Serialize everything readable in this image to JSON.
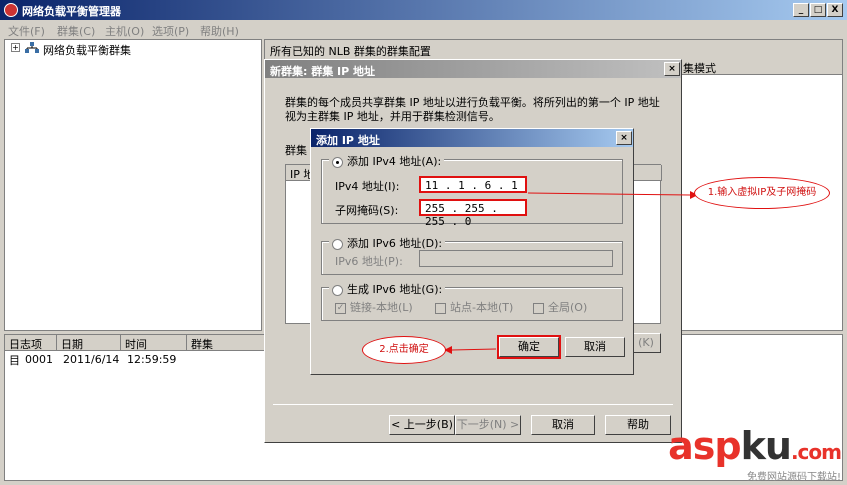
{
  "window": {
    "title": "网络负载平衡管理器",
    "min": "_",
    "max": "□",
    "close": "X"
  },
  "menu": [
    "文件(F)",
    "群集(C)",
    "主机(O)",
    "选项(P)",
    "帮助(H)"
  ],
  "tree": {
    "expand": "+",
    "root": "网络负载平衡群集"
  },
  "right_pane": {
    "header": "所有已知的 NLB 群集的群集配置",
    "col_mode": "集模式"
  },
  "log": {
    "columns": [
      "日志项目",
      "日期",
      "时间",
      "群集"
    ],
    "rows": [
      {
        "id": "0001",
        "date": "2011/6/14",
        "time": "12:59:59",
        "cluster": ""
      }
    ]
  },
  "nlb_dialog": {
    "title": "新群集:  群集 IP 地址",
    "desc": "群集的每个成员共享群集 IP 地址以进行负载平衡。将所列出的第一个 IP 地址视为主群集 IP 地址，并用于群集检测信号。",
    "label_cluster": "群集",
    "col_ip": "IP 地",
    "hidden_btn": "(K)",
    "back": "< 上一步(B)",
    "next": "下一步(N) >",
    "cancel": "取消",
    "help": "帮助"
  },
  "ip_dialog": {
    "title": "添加 IP 地址",
    "ipv4_radio": "添加 IPv4 地址(A):",
    "ipv4_label": "IPv4 地址(I):",
    "ipv4_value": "11 . 1 . 6 . 1",
    "mask_label": "子网掩码(S):",
    "mask_value": "255 . 255 . 255 . 0",
    "ipv6_radio": "添加 IPv6 地址(D):",
    "ipv6_label": "IPv6 地址(P):",
    "gen_radio": "生成 IPv6 地址(G):",
    "chk_link": "链接-本地(L)",
    "chk_site": "站点-本地(T)",
    "chk_global": "全局(O)",
    "ok": "确定",
    "cancel": "取消"
  },
  "annotations": {
    "step1": "1.输入虚拟IP及子网掩码",
    "step2": "2.点击确定",
    "color": "#e01010"
  },
  "watermark": {
    "brand_a": "asp",
    "brand_b": "ku",
    "brand_c": ".com",
    "tagline": "免费网站源码下载站!"
  }
}
